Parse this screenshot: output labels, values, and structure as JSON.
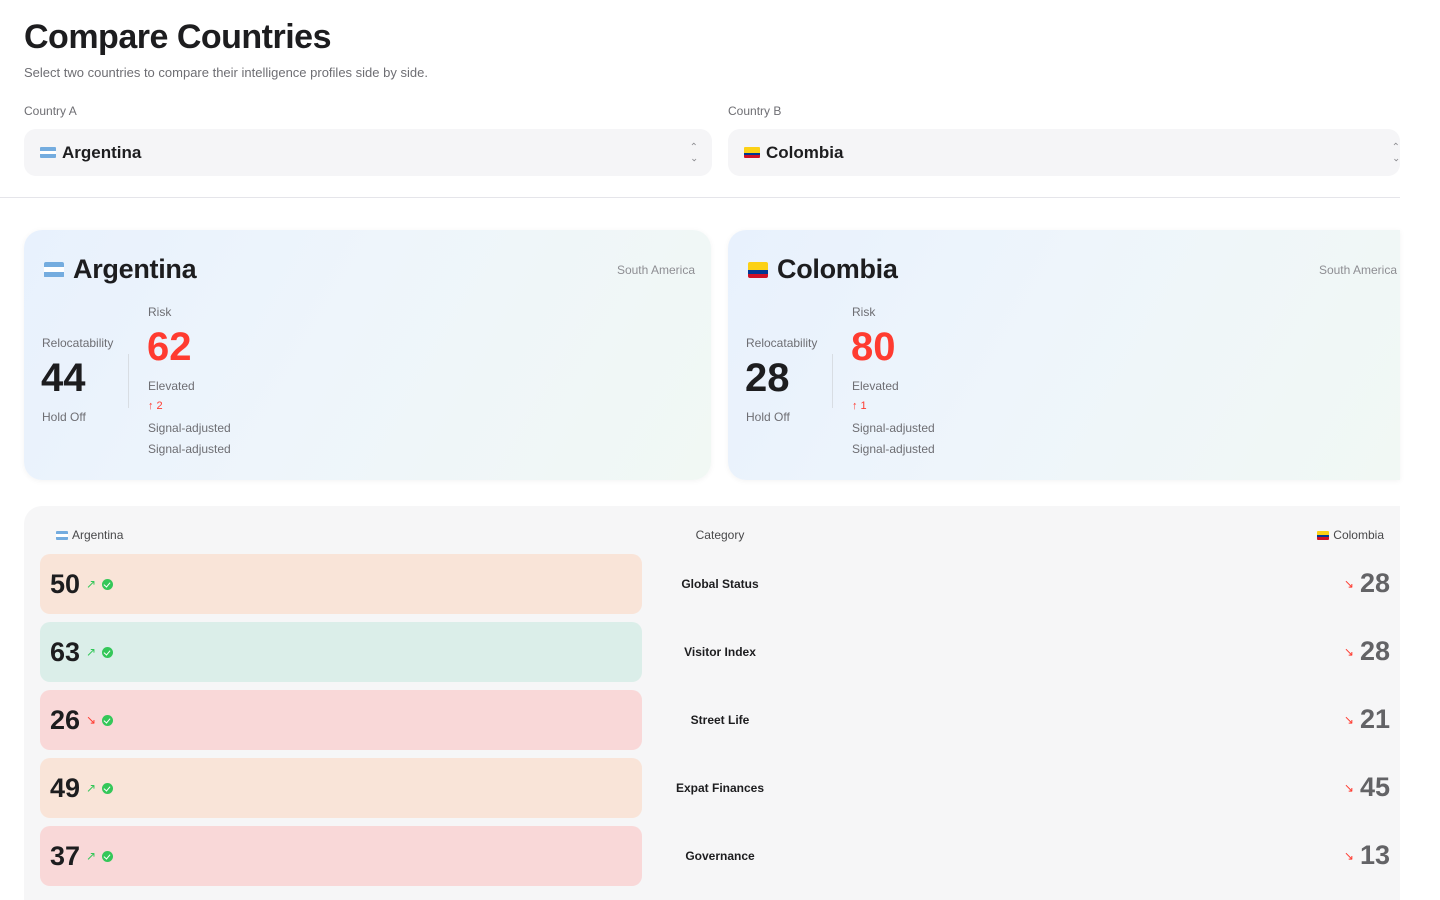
{
  "header": {
    "title": "Compare Countries",
    "subtitle": "Select two countries to compare their intelligence profiles side by side."
  },
  "selectors": {
    "a": {
      "label": "Country A",
      "value": "Argentina"
    },
    "b": {
      "label": "Country B",
      "value": "Colombia"
    }
  },
  "cards": {
    "a": {
      "name": "Argentina",
      "region": "South America",
      "relocatability_label": "Relocatability",
      "relocatability": "44",
      "relocatability_status": "Hold Off",
      "risk_label": "Risk",
      "risk": "62",
      "risk_status": "Elevated",
      "risk_delta": "↑ 2",
      "signal_1": "Signal-adjusted",
      "signal_2": "Signal-adjusted"
    },
    "b": {
      "name": "Colombia",
      "region": "South America",
      "relocatability_label": "Relocatability",
      "relocatability": "28",
      "relocatability_status": "Hold Off",
      "risk_label": "Risk",
      "risk": "80",
      "risk_status": "Elevated",
      "risk_delta": "↑ 1",
      "signal_1": "Signal-adjusted",
      "signal_2": "Signal-adjusted"
    }
  },
  "comparison": {
    "left_header": "Argentina",
    "center_header": "Category",
    "right_header": "Colombia",
    "rows": [
      {
        "category": "Global Status",
        "a": "50",
        "a_trend": "↗",
        "b": "28",
        "b_trend": "↘"
      },
      {
        "category": "Visitor Index",
        "a": "63",
        "a_trend": "↗",
        "b": "28",
        "b_trend": "↘"
      },
      {
        "category": "Street Life",
        "a": "26",
        "a_trend": "↘",
        "b": "21",
        "b_trend": "↘"
      },
      {
        "category": "Expat Finances",
        "a": "49",
        "a_trend": "↗",
        "b": "45",
        "b_trend": "↘"
      },
      {
        "category": "Governance",
        "a": "37",
        "a_trend": "↗",
        "b": "13",
        "b_trend": "↘"
      }
    ]
  },
  "colors": {
    "risk_red": "#ff3b30",
    "trend_up": "#34c759",
    "trend_down": "#ff3b30",
    "row_orange": "#f9e4d8",
    "row_green": "#dbeee9",
    "row_red": "#f9d8d8",
    "flag_argentina": [
      "#74acdf",
      "#ffffff",
      "#74acdf"
    ],
    "flag_colombia": [
      "#fcd116",
      "#003893",
      "#ce1126"
    ]
  },
  "icons": {
    "selector": "chevron-up-down-icon",
    "trend_up": "arrow-up-right-icon",
    "trend_down": "arrow-down-right-icon",
    "verified": "check-circle-icon"
  }
}
